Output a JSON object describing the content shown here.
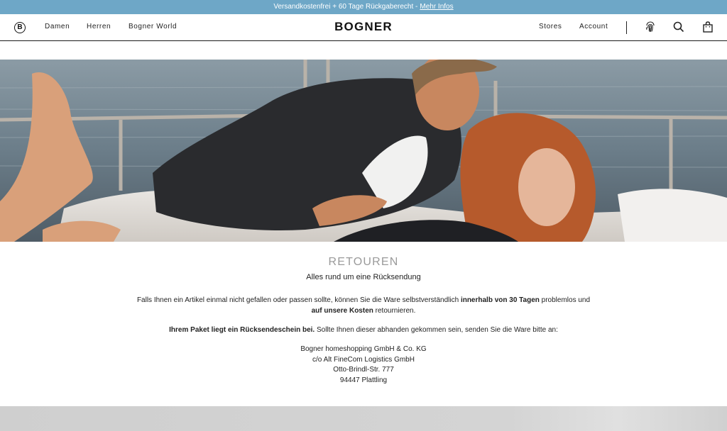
{
  "promo": {
    "text": "Versandkostenfrei + 60 Tage Rückgaberecht -",
    "link": "Mehr Infos"
  },
  "header": {
    "logo_letter": "B",
    "brand": "BOGNER",
    "nav_left": [
      "Damen",
      "Herren",
      "Bogner World"
    ],
    "nav_right": [
      "Stores",
      "Account"
    ],
    "icons": [
      "fingerprint-icon",
      "search-icon",
      "shopping-bag-icon"
    ]
  },
  "hero": {
    "description_icon": "hero-image"
  },
  "content": {
    "title": "RETOUREN",
    "subtitle": "Alles rund um eine Rücksendung",
    "para1": {
      "part1": "Falls Ihnen ein Artikel einmal nicht gefallen oder passen sollte, können Sie die Ware selbstverständlich ",
      "bold1": "innerhalb von 30 Tagen",
      "part2": " problemlos und",
      "bold2": "auf unsere Kosten",
      "part3": " retournieren."
    },
    "para2": {
      "bold": "Ihrem Paket liegt ein Rücksendeschein bei.",
      "rest": " Sollte Ihnen dieser abhanden gekommen sein, senden Sie die Ware bitte an:"
    },
    "address": [
      "Bogner homeshopping GmbH & Co. KG",
      "c/o Alt FineCom Logistics GmbH",
      "Otto-Brindl-Str. 777",
      "94447 Plattling"
    ]
  }
}
